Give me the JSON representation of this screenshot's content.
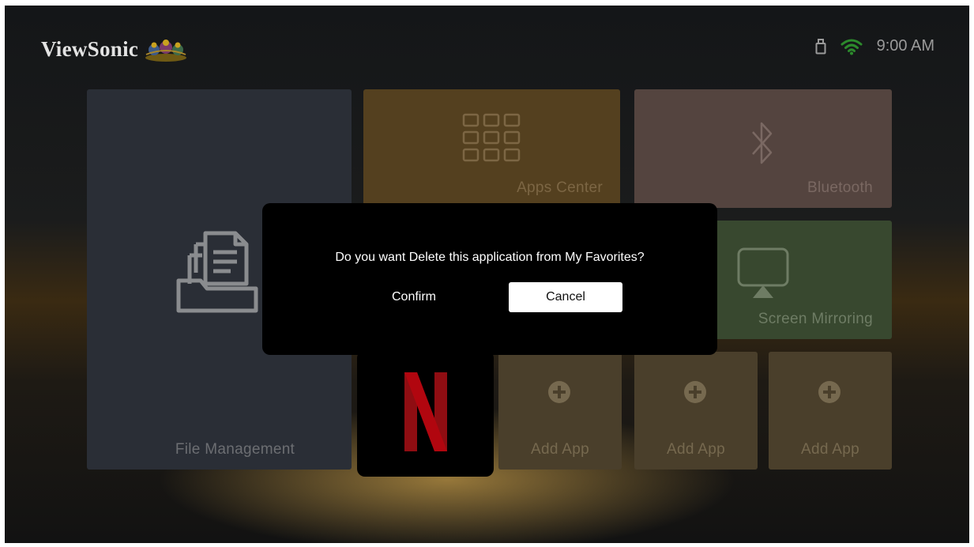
{
  "header": {
    "brand": "ViewSonic",
    "time": "9:00 AM",
    "icons": [
      "usb-icon",
      "wifi-icon"
    ]
  },
  "tiles": {
    "file_management": "File Management",
    "apps_center": "Apps Center",
    "bluetooth": "Bluetooth",
    "screen_mirroring": "Screen Mirroring",
    "netflix": "Netflix",
    "add_app_1": "Add App",
    "add_app_2": "Add App",
    "add_app_3": "Add App"
  },
  "dialog": {
    "message": "Do you want Delete this application from My Favorites?",
    "confirm": "Confirm",
    "cancel": "Cancel",
    "focused": "cancel"
  },
  "colors": {
    "dialog_bg": "#000000",
    "netflix_red": "#b1060f",
    "focus_button_bg": "#ffffff"
  }
}
